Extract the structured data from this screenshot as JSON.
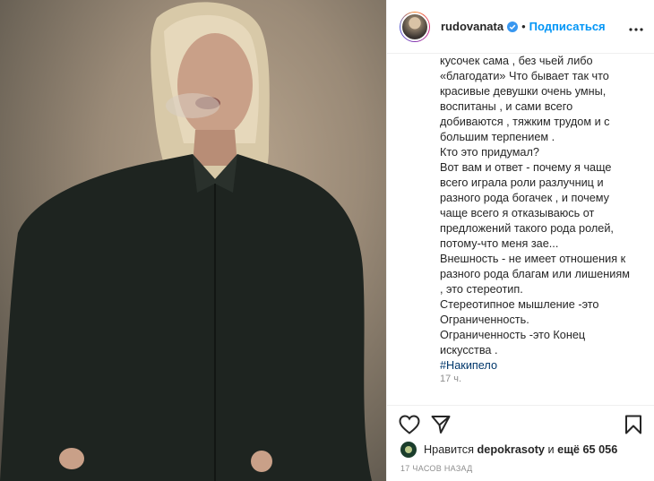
{
  "post": {
    "username": "rudovanata",
    "follow_label": "Подписаться",
    "separator": "•",
    "caption_lines": [
      "кусочек сама , без чьей либо",
      "«благодати» Что бывает так что",
      "красивые девушки очень умны,",
      "воспитаны , и сами всего",
      "добиваются , тяжким трудом и с",
      "большим терпением .",
      "Кто это придумал?",
      "Вот вам и ответ - почему я чаще",
      "всего играла роли разлучниц и",
      "разного рода богачек , и почему",
      "чаще всего я отказываюсь от",
      "предложений такого рода ролей,",
      "потому-что меня зае...",
      "Внешность - не имеет отношения к",
      "разного рода благам или лишениям",
      ", это стереотип.",
      "Стереотипное мышление -это",
      "Ограниченность.",
      "Ограниченность -это Конец",
      "искусства ."
    ],
    "hashtag": "#Накипело",
    "comment_time": "17 ч.",
    "likes": {
      "prefix": "Нравится",
      "user": "depokrasoty",
      "middle": "и",
      "count_text": "ещё 65 056"
    },
    "posted_ago": "17 ЧАСОВ НАЗАД"
  },
  "icons": {
    "verified": "verified-badge-icon",
    "more": "more-options-icon",
    "like": "heart-icon",
    "share": "share-icon",
    "save": "bookmark-icon"
  },
  "colors": {
    "link": "#0095f6",
    "hashtag": "#00376b",
    "muted": "#8e8e8e"
  }
}
